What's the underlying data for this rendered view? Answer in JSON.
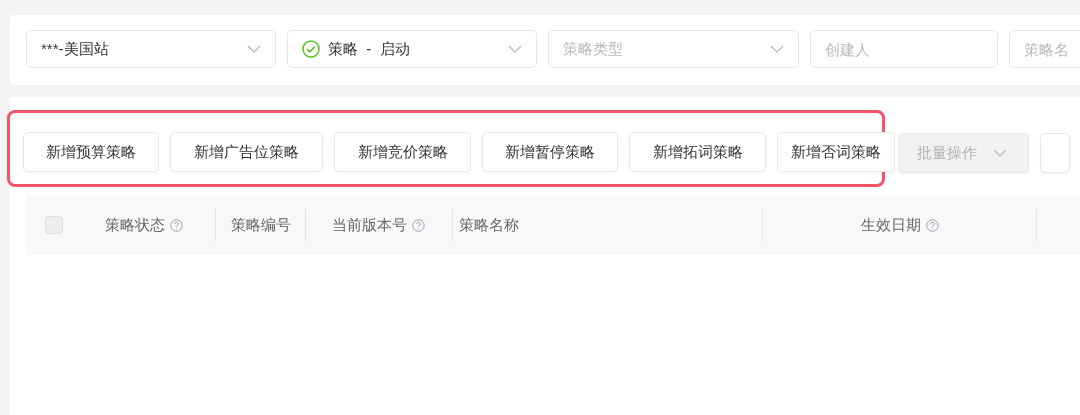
{
  "filters": [
    {
      "kind": "select",
      "value": "***-美国站"
    },
    {
      "kind": "status-select",
      "value": "策略  -  启动"
    },
    {
      "kind": "select",
      "placeholder": "策略类型"
    },
    {
      "kind": "input",
      "placeholder": "创建人"
    },
    {
      "kind": "input",
      "placeholder": "策略名"
    }
  ],
  "highlighted_buttons": [
    "新增预算策略",
    "新增广告位策略",
    "新增竞价策略",
    "新增暂停策略",
    "新增拓词策略",
    "新增否词策略"
  ],
  "batch_button": {
    "label": "批量操作",
    "disabled": true
  },
  "table": {
    "select_all": {
      "checked": false
    },
    "columns": [
      {
        "label": "策略状态",
        "help": true
      },
      {
        "label": "策略编号",
        "help": false
      },
      {
        "label": "当前版本号",
        "help": true
      },
      {
        "label": "策略名称",
        "help": false
      },
      {
        "label": "生效日期",
        "help": true
      }
    ]
  }
}
